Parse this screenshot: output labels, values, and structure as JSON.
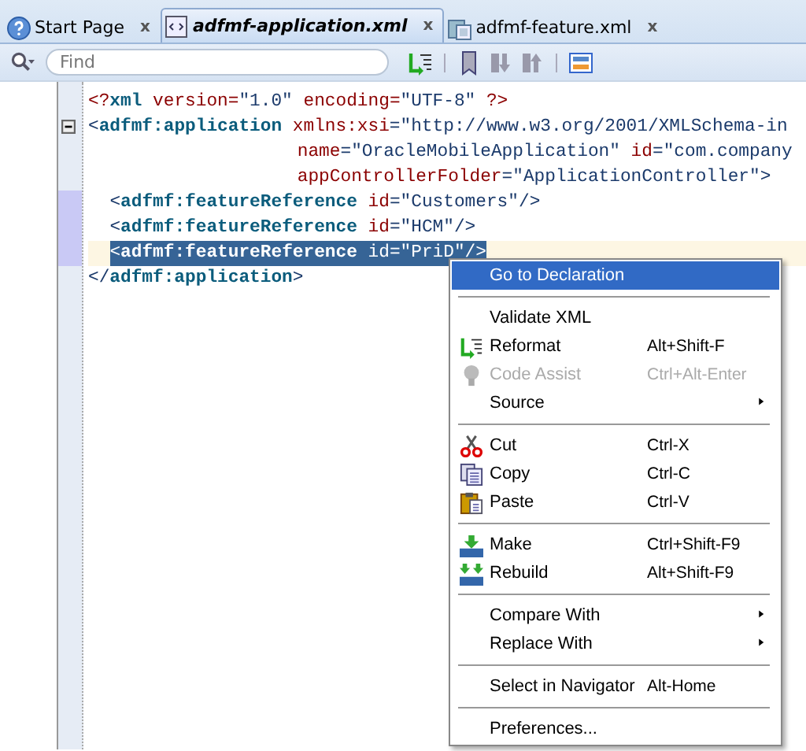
{
  "tabs": [
    {
      "label": "Start Page",
      "close": "x",
      "selected": false,
      "kind": "help"
    },
    {
      "label": "adfmf-application.xml",
      "close": "x",
      "selected": true,
      "kind": "xml"
    },
    {
      "label": "adfmf-feature.xml",
      "close": "x",
      "selected": false,
      "kind": "feature"
    }
  ],
  "search": {
    "placeholder": "Find"
  },
  "code_lines": [
    {
      "selected": false,
      "current": false,
      "fold": false,
      "changed": false,
      "tokens": [
        {
          "kind": "pi",
          "text": "<?"
        },
        {
          "kind": "tag",
          "text": "xml"
        },
        {
          "kind": "attr",
          "text": " version"
        },
        {
          "kind": "pi",
          "text": "="
        },
        {
          "kind": "value",
          "text": "\"1.0\""
        },
        {
          "kind": "attr",
          "text": " encoding"
        },
        {
          "kind": "pi",
          "text": "="
        },
        {
          "kind": "value",
          "text": "\"UTF-8\""
        },
        {
          "kind": "pi",
          "text": " ?>"
        }
      ]
    },
    {
      "selected": false,
      "current": false,
      "fold": true,
      "changed": false,
      "tokens": [
        {
          "kind": "punct",
          "text": "<"
        },
        {
          "kind": "tag",
          "text": "adfmf:application"
        },
        {
          "kind": "attr",
          "text": " xmlns:xsi"
        },
        {
          "kind": "punct",
          "text": "="
        },
        {
          "kind": "value",
          "text": "\"http://www.w3.org/2001/XMLSchema-in"
        }
      ]
    },
    {
      "selected": false,
      "current": false,
      "fold": false,
      "changed": false,
      "kind": "continuation",
      "tokens": [
        {
          "kind": "attr",
          "text": "name"
        },
        {
          "kind": "punct",
          "text": "="
        },
        {
          "kind": "value",
          "text": "\"OracleMobileApplication\""
        },
        {
          "kind": "attr",
          "text": " id"
        },
        {
          "kind": "punct",
          "text": "="
        },
        {
          "kind": "value",
          "text": "\"com.company"
        }
      ]
    },
    {
      "selected": false,
      "current": false,
      "fold": false,
      "changed": false,
      "kind": "continuation",
      "tokens": [
        {
          "kind": "attr",
          "text": "appControllerFolder"
        },
        {
          "kind": "punct",
          "text": "="
        },
        {
          "kind": "value",
          "text": "\"ApplicationController\""
        },
        {
          "kind": "punct",
          "text": ">"
        }
      ]
    },
    {
      "selected": false,
      "current": false,
      "fold": false,
      "changed": true,
      "kind": "child",
      "tokens": [
        {
          "kind": "punct",
          "text": "<"
        },
        {
          "kind": "tag",
          "text": "adfmf:featureReference"
        },
        {
          "kind": "attr",
          "text": " id"
        },
        {
          "kind": "punct",
          "text": "="
        },
        {
          "kind": "value",
          "text": "\"Customers\""
        },
        {
          "kind": "punct",
          "text": "/>"
        }
      ]
    },
    {
      "selected": false,
      "current": false,
      "fold": false,
      "changed": true,
      "kind": "child",
      "tokens": [
        {
          "kind": "punct",
          "text": "<"
        },
        {
          "kind": "tag",
          "text": "adfmf:featureReference"
        },
        {
          "kind": "attr",
          "text": " id"
        },
        {
          "kind": "punct",
          "text": "="
        },
        {
          "kind": "value",
          "text": "\"HCM\""
        },
        {
          "kind": "punct",
          "text": "/>"
        }
      ]
    },
    {
      "selected": true,
      "current": true,
      "fold": false,
      "changed": true,
      "kind": "child",
      "tokens": [
        {
          "kind": "punct",
          "text": "<"
        },
        {
          "kind": "tag",
          "text": "adfmf:featureReference"
        },
        {
          "kind": "attr",
          "text": " id"
        },
        {
          "kind": "punct",
          "text": "="
        },
        {
          "kind": "value",
          "text": "\"PriD\""
        },
        {
          "kind": "punct",
          "text": "/>"
        }
      ]
    },
    {
      "selected": false,
      "current": false,
      "fold": false,
      "changed": false,
      "tokens": [
        {
          "kind": "punct",
          "text": "</"
        },
        {
          "kind": "tag",
          "text": "adfmf:application"
        },
        {
          "kind": "punct",
          "text": ">"
        }
      ]
    }
  ],
  "context_menu": [
    {
      "kind": "item",
      "label": "Go to Declaration",
      "selected": true,
      "disabled": false,
      "submenu": false
    },
    {
      "kind": "separator"
    },
    {
      "kind": "item",
      "label": "Validate XML",
      "selected": false,
      "disabled": false,
      "submenu": false
    },
    {
      "kind": "item",
      "label": "Reformat",
      "shortcut": "Alt+Shift-F",
      "selected": false,
      "disabled": false,
      "submenu": false
    },
    {
      "kind": "item",
      "label": "Code Assist",
      "shortcut": "Ctrl+Alt-Enter",
      "selected": false,
      "disabled": true,
      "submenu": false
    },
    {
      "kind": "item",
      "label": "Source",
      "selected": false,
      "disabled": false,
      "submenu": true
    },
    {
      "kind": "separator"
    },
    {
      "kind": "item",
      "label": "Cut",
      "shortcut": "Ctrl-X",
      "selected": false,
      "disabled": false,
      "submenu": false
    },
    {
      "kind": "item",
      "label": "Copy",
      "shortcut": "Ctrl-C",
      "selected": false,
      "disabled": false,
      "submenu": false
    },
    {
      "kind": "item",
      "label": "Paste",
      "shortcut": "Ctrl-V",
      "selected": false,
      "disabled": false,
      "submenu": false
    },
    {
      "kind": "separator"
    },
    {
      "kind": "item",
      "label": "Make",
      "shortcut": "Ctrl+Shift-F9",
      "selected": false,
      "disabled": false,
      "submenu": false
    },
    {
      "kind": "item",
      "label": "Rebuild",
      "shortcut": "Alt+Shift-F9",
      "selected": false,
      "disabled": false,
      "submenu": false
    },
    {
      "kind": "separator"
    },
    {
      "kind": "item",
      "label": "Compare With",
      "selected": false,
      "disabled": false,
      "submenu": true
    },
    {
      "kind": "item",
      "label": "Replace With",
      "selected": false,
      "disabled": false,
      "submenu": true
    },
    {
      "kind": "separator"
    },
    {
      "kind": "item",
      "label": "Select in Navigator",
      "shortcut": "Alt-Home",
      "selected": false,
      "disabled": false,
      "submenu": false
    },
    {
      "kind": "separator"
    },
    {
      "kind": "item",
      "label": "Preferences...",
      "selected": false,
      "disabled": false,
      "submenu": false
    }
  ]
}
